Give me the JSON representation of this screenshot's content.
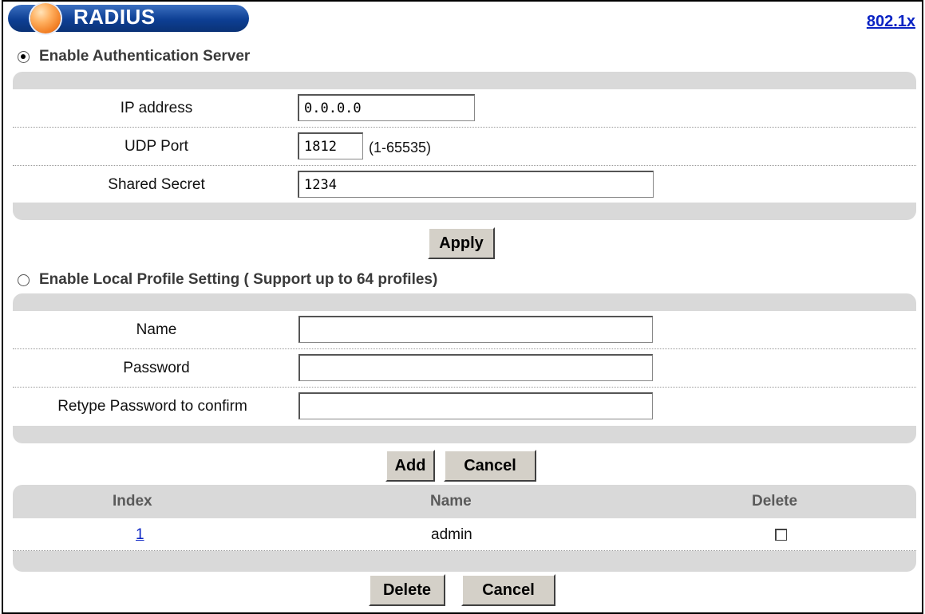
{
  "header": {
    "title": "RADIUS",
    "top_link": "802.1x"
  },
  "auth_server": {
    "radio_label": "Enable Authentication Server",
    "selected": true,
    "fields": {
      "ip_label": "IP address",
      "ip_value": "0.0.0.0",
      "udp_label": "UDP Port",
      "udp_value": "1812",
      "udp_hint": "(1-65535)",
      "secret_label": "Shared Secret",
      "secret_value": "1234"
    },
    "apply_label": "Apply"
  },
  "local_profile": {
    "radio_label": "Enable Local Profile Setting ( Support up to  64  profiles)",
    "selected": false,
    "fields": {
      "name_label": "Name",
      "name_value": "",
      "password_label": "Password",
      "password_value": "",
      "retype_label": "Retype Password to confirm",
      "retype_value": ""
    },
    "add_label": "Add",
    "cancel_label": "Cancel"
  },
  "profiles_table": {
    "columns": [
      "Index",
      "Name",
      "Delete"
    ],
    "rows": [
      {
        "index": "1",
        "name": "admin",
        "delete_checked": false
      }
    ],
    "delete_label": "Delete",
    "cancel_label": "Cancel"
  },
  "colors": {
    "title_pill": "#0d3f93",
    "orb": "#f07a1e",
    "link": "#0b24c4",
    "panel_gray": "#d9d9d9",
    "button_face": "#d4d0c8"
  }
}
